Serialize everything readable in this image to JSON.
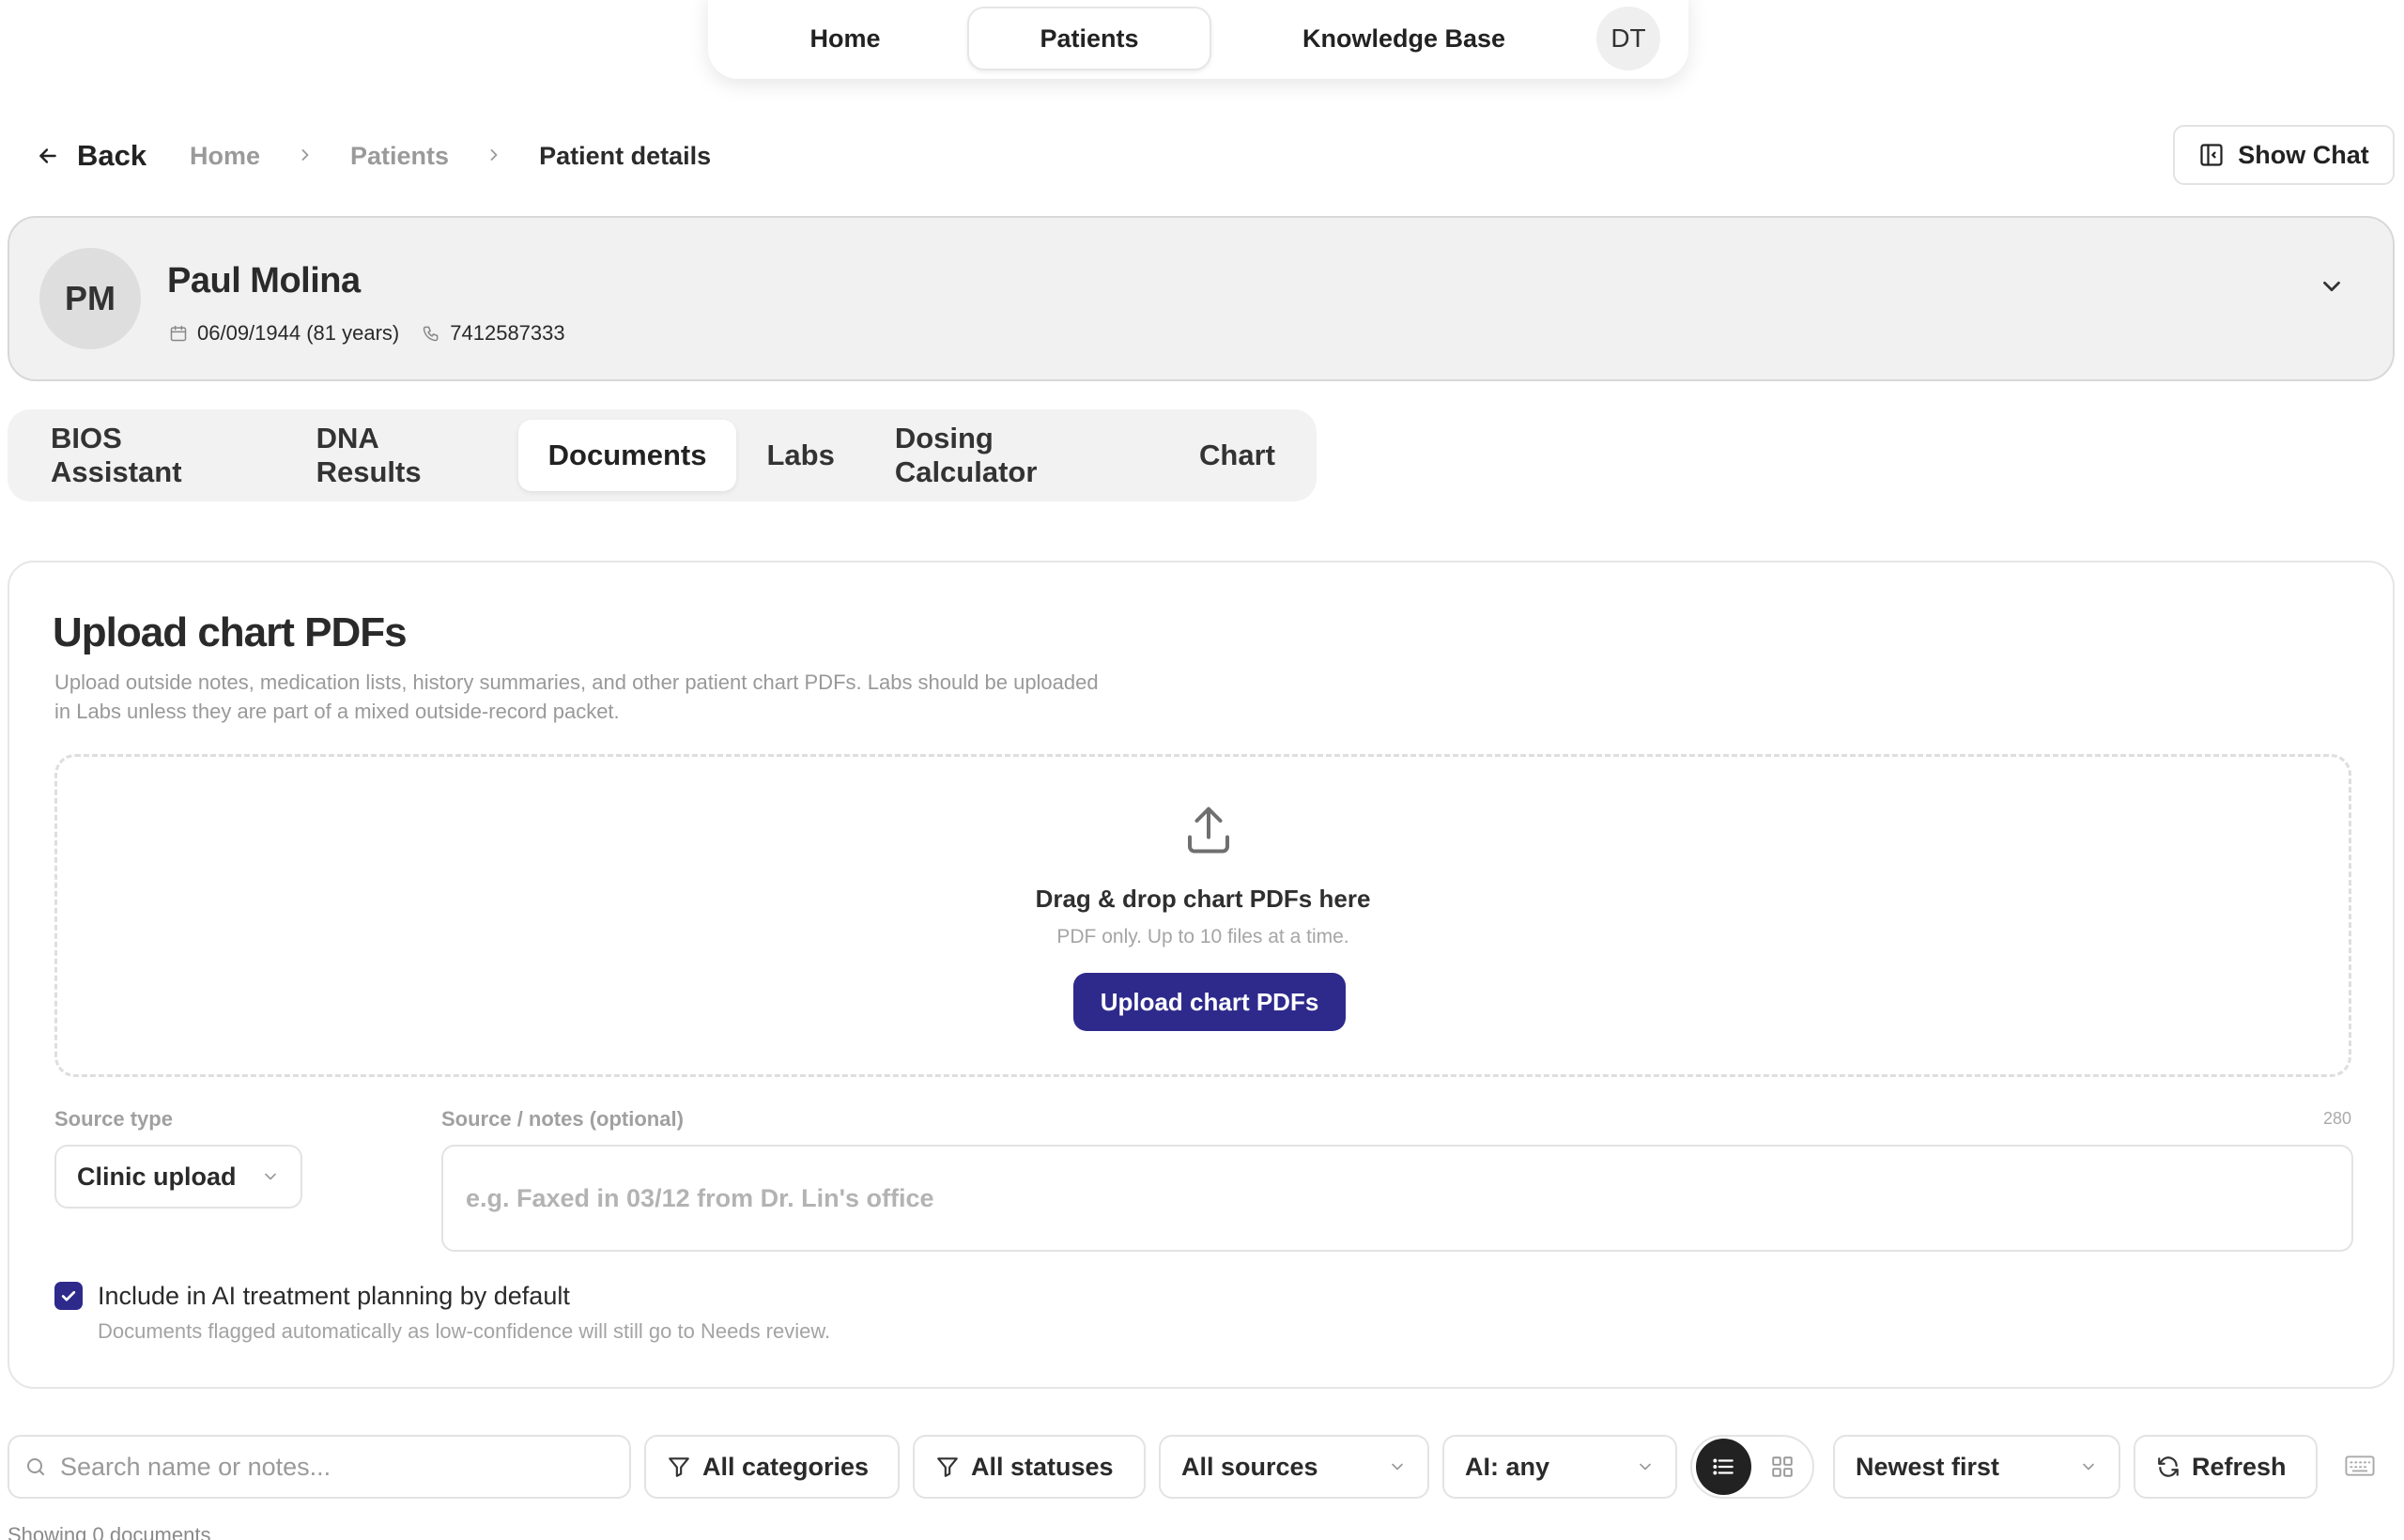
{
  "nav": {
    "items": [
      {
        "label": "Home"
      },
      {
        "label": "Patients"
      },
      {
        "label": "Knowledge Base"
      }
    ],
    "avatar_initials": "DT",
    "active": "Patients"
  },
  "breadcrumb": {
    "back_label": "Back",
    "items": [
      "Home",
      "Patients",
      "Patient details"
    ]
  },
  "header_actions": {
    "show_chat_label": "Show Chat"
  },
  "patient": {
    "initials": "PM",
    "name": "Paul Molina",
    "dob": "06/09/1944 (81 years)",
    "phone": "7412587333"
  },
  "tabs": {
    "items": [
      "BIOS Assistant",
      "DNA Results",
      "Documents",
      "Labs",
      "Dosing Calculator",
      "Chart"
    ],
    "active": "Documents"
  },
  "upload": {
    "title": "Upload chart PDFs",
    "description": "Upload outside notes, medication lists, history summaries, and other patient chart PDFs. Labs should be uploaded in Labs unless they are part of a mixed outside-record packet.",
    "dropzone_title": "Drag & drop chart PDFs here",
    "dropzone_subtitle": "PDF only. Up to 10 files at a time.",
    "button_label": "Upload chart PDFs",
    "source_type_label": "Source type",
    "source_type_value": "Clinic upload",
    "notes_label": "Source / notes (optional)",
    "notes_max": "280",
    "notes_placeholder": "e.g. Faxed in 03/12 from Dr. Lin's office",
    "include_ai_label": "Include in AI treatment planning by default",
    "include_ai_checked": true,
    "include_ai_help": "Documents flagged automatically as low-confidence will still go to Needs review."
  },
  "toolbar": {
    "search_placeholder": "Search name or notes...",
    "categories_label": "All categories",
    "statuses_label": "All statuses",
    "sources_label": "All sources",
    "ai_label": "AI: any",
    "view_mode": "list",
    "sort_label": "Newest first",
    "refresh_label": "Refresh"
  },
  "results": {
    "showing_text": "Showing 0 documents"
  },
  "colors": {
    "accent": "#2e2a8c",
    "muted_text": "#9a9a9a",
    "border": "#e3e3e3"
  }
}
